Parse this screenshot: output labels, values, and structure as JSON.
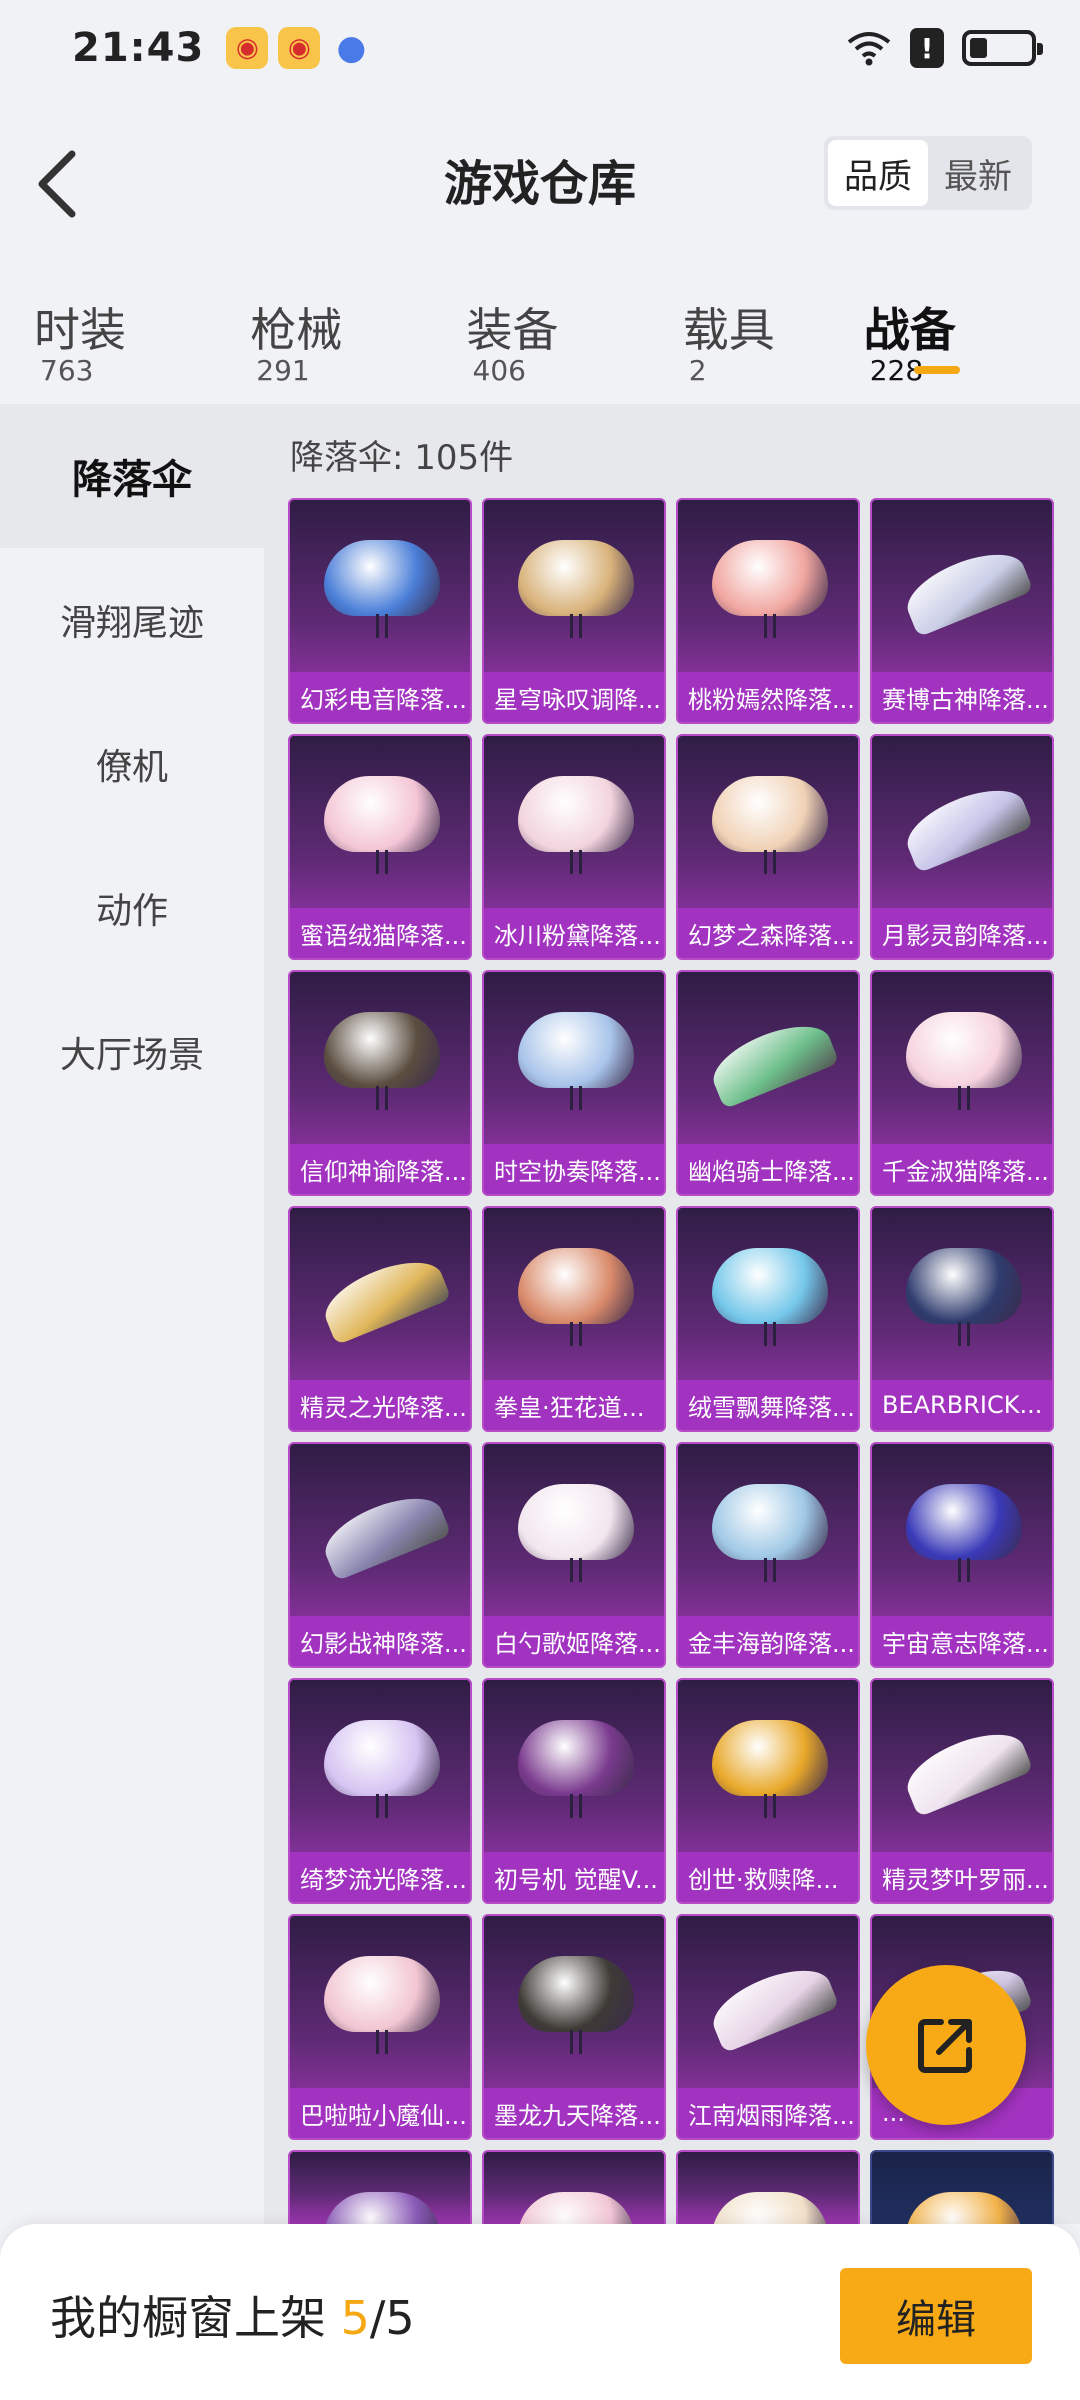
{
  "status_bar": {
    "time": "21:43",
    "icons": [
      "weibo-icon",
      "weibo-icon",
      "browser-icon",
      "wifi-icon",
      "alert-icon",
      "battery-icon"
    ],
    "alert_glyph": "!",
    "battery_level": 0.3
  },
  "header": {
    "title": "游戏仓库",
    "sort_options": [
      "品质",
      "最新"
    ],
    "sort_selected": "品质"
  },
  "tabs": [
    {
      "label": "时装",
      "count": "763"
    },
    {
      "label": "枪械",
      "count": "291"
    },
    {
      "label": "装备",
      "count": "406"
    },
    {
      "label": "载具",
      "count": "2"
    },
    {
      "label": "战备",
      "count": "228",
      "active": true
    }
  ],
  "sidebar": {
    "items": [
      "降落伞",
      "滑翔尾迹",
      "僚机",
      "动作",
      "大厅场景"
    ],
    "active": "降落伞"
  },
  "main": {
    "count_label": "降落伞: 105件",
    "items": [
      {
        "name": "幻彩电音降落...",
        "color": "#4a7ed8",
        "shape": "dome"
      },
      {
        "name": "星穹咏叹调降...",
        "color": "#d8b27a",
        "shape": "dome"
      },
      {
        "name": "桃粉嫣然降落...",
        "color": "#f1a6a0",
        "shape": "dome"
      },
      {
        "name": "赛博古神降落...",
        "color": "#c9cde6",
        "shape": "wing"
      },
      {
        "name": "蜜语绒猫降落...",
        "color": "#f4c6d6",
        "shape": "dome"
      },
      {
        "name": "冰川粉黛降落...",
        "color": "#f2d4dd",
        "shape": "dome"
      },
      {
        "name": "幻梦之森降落...",
        "color": "#f0d2b6",
        "shape": "dome"
      },
      {
        "name": "月影灵韵降落...",
        "color": "#c6c3e8",
        "shape": "wing"
      },
      {
        "name": "信仰神谕降落...",
        "color": "#5b4e40",
        "shape": "dome"
      },
      {
        "name": "时空协奏降落...",
        "color": "#a8c4ea",
        "shape": "dome"
      },
      {
        "name": "幽焰骑士降落...",
        "color": "#6dbf8a",
        "shape": "wing"
      },
      {
        "name": "千金淑猫降落...",
        "color": "#f6d3df",
        "shape": "dome"
      },
      {
        "name": "精灵之光降落...",
        "color": "#e0b65a",
        "shape": "wing"
      },
      {
        "name": "拳皇·狂花道...",
        "color": "#d98a6a",
        "shape": "dome"
      },
      {
        "name": "绒雪飘舞降落...",
        "color": "#74c7ea",
        "shape": "dome"
      },
      {
        "name": "BEARBRICK...",
        "color": "#2f3c6e",
        "shape": "dome"
      },
      {
        "name": "幻影战神降落...",
        "color": "#8a86b0",
        "shape": "wing"
      },
      {
        "name": "白勺歌姬降落...",
        "color": "#f2e6ee",
        "shape": "dome"
      },
      {
        "name": "金丰海韵降落...",
        "color": "#9fc8e6",
        "shape": "dome"
      },
      {
        "name": "宇宙意志降落...",
        "color": "#3a3ab8",
        "shape": "dome"
      },
      {
        "name": "绮梦流光降落...",
        "color": "#d6c4f2",
        "shape": "dome"
      },
      {
        "name": "初号机 觉醒V...",
        "color": "#7a3a8e",
        "shape": "dome"
      },
      {
        "name": "创世·救赎降...",
        "color": "#e8a82a",
        "shape": "dome"
      },
      {
        "name": "精灵梦叶罗丽...",
        "color": "#efe4ef",
        "shape": "wing"
      },
      {
        "name": "巴啦啦小魔仙...",
        "color": "#f2c6d2",
        "shape": "dome"
      },
      {
        "name": "墨龙九天降落...",
        "color": "#3e3a36",
        "shape": "dome"
      },
      {
        "name": "江南烟雨降落...",
        "color": "#e7d4e6",
        "shape": "wing"
      },
      {
        "name": "...",
        "color": "#d4c8e6",
        "shape": "wing"
      }
    ],
    "partial_items": [
      {
        "color": "#8a5ab8"
      },
      {
        "color": "#f2c6d6"
      },
      {
        "color": "#f2e0c8"
      },
      {
        "color": "#f2b24a",
        "dark": true
      }
    ]
  },
  "fab": {
    "icon": "share-icon"
  },
  "bottom_bar": {
    "label_prefix": "我的橱窗上架 ",
    "current": "5",
    "separator": "/",
    "total": "5",
    "edit_label": "编辑"
  },
  "accent_color": "#f5a814"
}
